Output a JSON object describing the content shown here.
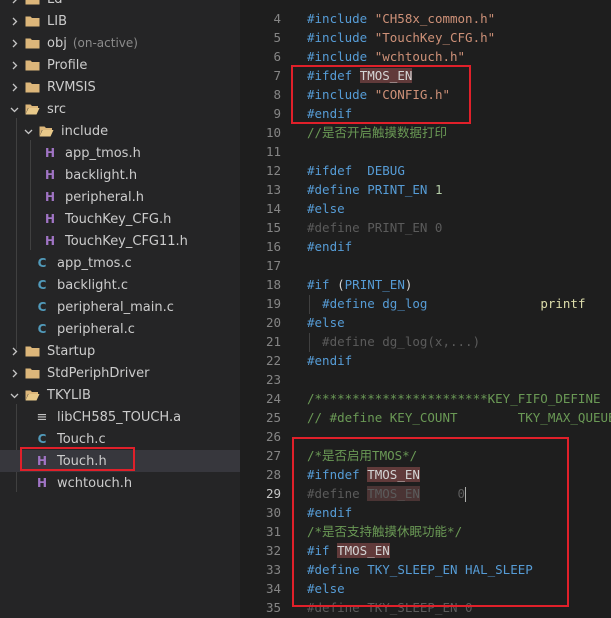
{
  "explorer": {
    "items": [
      {
        "kind": "folder",
        "label": "Ld",
        "open": false,
        "depth": 0
      },
      {
        "kind": "folder",
        "label": "LIB",
        "open": false,
        "depth": 0
      },
      {
        "kind": "folder",
        "label": "obj",
        "desc": "(on-active)",
        "open": false,
        "depth": 0
      },
      {
        "kind": "folder",
        "label": "Profile",
        "open": false,
        "depth": 0
      },
      {
        "kind": "folder",
        "label": "RVMSIS",
        "open": false,
        "depth": 0
      },
      {
        "kind": "folder",
        "label": "src",
        "open": true,
        "depth": 0
      },
      {
        "kind": "folder",
        "label": "include",
        "open": true,
        "depth": 1
      },
      {
        "kind": "h",
        "label": "app_tmos.h",
        "depth": 2
      },
      {
        "kind": "h",
        "label": "backlight.h",
        "depth": 2
      },
      {
        "kind": "h",
        "label": "peripheral.h",
        "depth": 2
      },
      {
        "kind": "h",
        "label": "TouchKey_CFG.h",
        "depth": 2
      },
      {
        "kind": "h",
        "label": "TouchKey_CFG11.h",
        "depth": 2
      },
      {
        "kind": "c",
        "label": "app_tmos.c",
        "depth": 1
      },
      {
        "kind": "c",
        "label": "backlight.c",
        "depth": 1
      },
      {
        "kind": "c",
        "label": "peripheral_main.c",
        "depth": 1
      },
      {
        "kind": "c",
        "label": "peripheral.c",
        "depth": 1
      },
      {
        "kind": "folder",
        "label": "Startup",
        "open": false,
        "depth": 0
      },
      {
        "kind": "folder",
        "label": "StdPeriphDriver",
        "open": false,
        "depth": 0
      },
      {
        "kind": "folder",
        "label": "TKYLIB",
        "open": true,
        "depth": 0
      },
      {
        "kind": "a",
        "label": "libCH585_TOUCH.a",
        "depth": 1
      },
      {
        "kind": "c",
        "label": "Touch.c",
        "depth": 1
      },
      {
        "kind": "h",
        "label": "Touch.h",
        "depth": 1,
        "selected": true
      },
      {
        "kind": "h",
        "label": "wchtouch.h",
        "depth": 1
      }
    ],
    "icons": {
      "h": "H",
      "c": "C",
      "a": "≡"
    }
  },
  "editor": {
    "active_line": 29,
    "lines": [
      {
        "n": "4",
        "segs": [
          [
            "pp",
            "#include "
          ],
          [
            "str",
            "\"CH58x_common.h\""
          ]
        ]
      },
      {
        "n": "5",
        "segs": [
          [
            "pp",
            "#include "
          ],
          [
            "str",
            "\"TouchKey_CFG.h\""
          ]
        ]
      },
      {
        "n": "6",
        "segs": [
          [
            "pp",
            "#include "
          ],
          [
            "str",
            "\"wchtouch.h\""
          ]
        ]
      },
      {
        "n": "7",
        "segs": [
          [
            "pp",
            "#ifdef "
          ],
          [
            "hl",
            "TMOS_EN"
          ]
        ]
      },
      {
        "n": "8",
        "segs": [
          [
            "pp",
            "#include "
          ],
          [
            "str",
            "\"CONFIG.h\""
          ]
        ]
      },
      {
        "n": "9",
        "segs": [
          [
            "pp",
            "#endif"
          ]
        ]
      },
      {
        "n": "10",
        "segs": [
          [
            "cmt",
            "//是否开启触摸数据打印"
          ]
        ]
      },
      {
        "n": "11",
        "segs": []
      },
      {
        "n": "12",
        "segs": [
          [
            "pp",
            "#ifdef  "
          ],
          [
            "macro",
            "DEBUG"
          ]
        ]
      },
      {
        "n": "13",
        "segs": [
          [
            "pp",
            "#define "
          ],
          [
            "macro",
            "PRINT_EN "
          ],
          [
            "num",
            "1"
          ]
        ]
      },
      {
        "n": "14",
        "segs": [
          [
            "pp",
            "#else"
          ]
        ]
      },
      {
        "n": "15",
        "segs": [
          [
            "dim",
            "#define PRINT_EN 0"
          ]
        ]
      },
      {
        "n": "16",
        "segs": [
          [
            "pp",
            "#endif"
          ]
        ]
      },
      {
        "n": "17",
        "segs": []
      },
      {
        "n": "18",
        "segs": [
          [
            "pp",
            "#if "
          ],
          [
            "plain",
            "("
          ],
          [
            "macro",
            "PRINT_EN"
          ],
          [
            "plain",
            ")"
          ]
        ]
      },
      {
        "n": "19",
        "segs": [
          [
            "plain",
            "  "
          ],
          [
            "pp",
            "#define "
          ],
          [
            "macro",
            "dg_log"
          ],
          [
            "plain",
            "               "
          ],
          [
            "fn",
            "printf"
          ]
        ]
      },
      {
        "n": "20",
        "segs": [
          [
            "pp",
            "#else"
          ]
        ]
      },
      {
        "n": "21",
        "segs": [
          [
            "dim",
            "  #define dg_log(x,...)"
          ]
        ]
      },
      {
        "n": "22",
        "segs": [
          [
            "pp",
            "#endif"
          ]
        ]
      },
      {
        "n": "23",
        "segs": []
      },
      {
        "n": "24",
        "segs": [
          [
            "cmt",
            "/***********************KEY_FIFO_DEFINE"
          ]
        ]
      },
      {
        "n": "25",
        "segs": [
          [
            "cmt",
            "// #define KEY_COUNT        TKY_MAX_QUEUE"
          ]
        ]
      },
      {
        "n": "26",
        "segs": []
      },
      {
        "n": "27",
        "segs": [
          [
            "cmt",
            "/*是否启用TMOS*/"
          ]
        ]
      },
      {
        "n": "28",
        "segs": [
          [
            "pp",
            "#ifndef "
          ],
          [
            "hl",
            "TMOS_EN"
          ]
        ]
      },
      {
        "n": "29",
        "segs": [
          [
            "dim",
            "#define "
          ],
          [
            "dimhl",
            "TMOS_EN"
          ],
          [
            "dim",
            "     0"
          ],
          [
            "cursor",
            ""
          ]
        ]
      },
      {
        "n": "30",
        "segs": [
          [
            "pp",
            "#endif"
          ]
        ]
      },
      {
        "n": "31",
        "segs": [
          [
            "cmt",
            "/*是否支持触摸休眠功能*/"
          ]
        ]
      },
      {
        "n": "32",
        "segs": [
          [
            "pp",
            "#if "
          ],
          [
            "hl",
            "TMOS_EN"
          ]
        ]
      },
      {
        "n": "33",
        "segs": [
          [
            "pp",
            "#define "
          ],
          [
            "macro",
            "TKY_SLEEP_EN HAL_SLEEP"
          ]
        ]
      },
      {
        "n": "34",
        "segs": [
          [
            "pp",
            "#else"
          ]
        ]
      },
      {
        "n": "35",
        "segs": [
          [
            "dim",
            "#define TKY_SLEEP_EN 0"
          ]
        ]
      }
    ]
  },
  "colors": {
    "annotation_red": "#e0202a",
    "selection": "#37373d"
  }
}
